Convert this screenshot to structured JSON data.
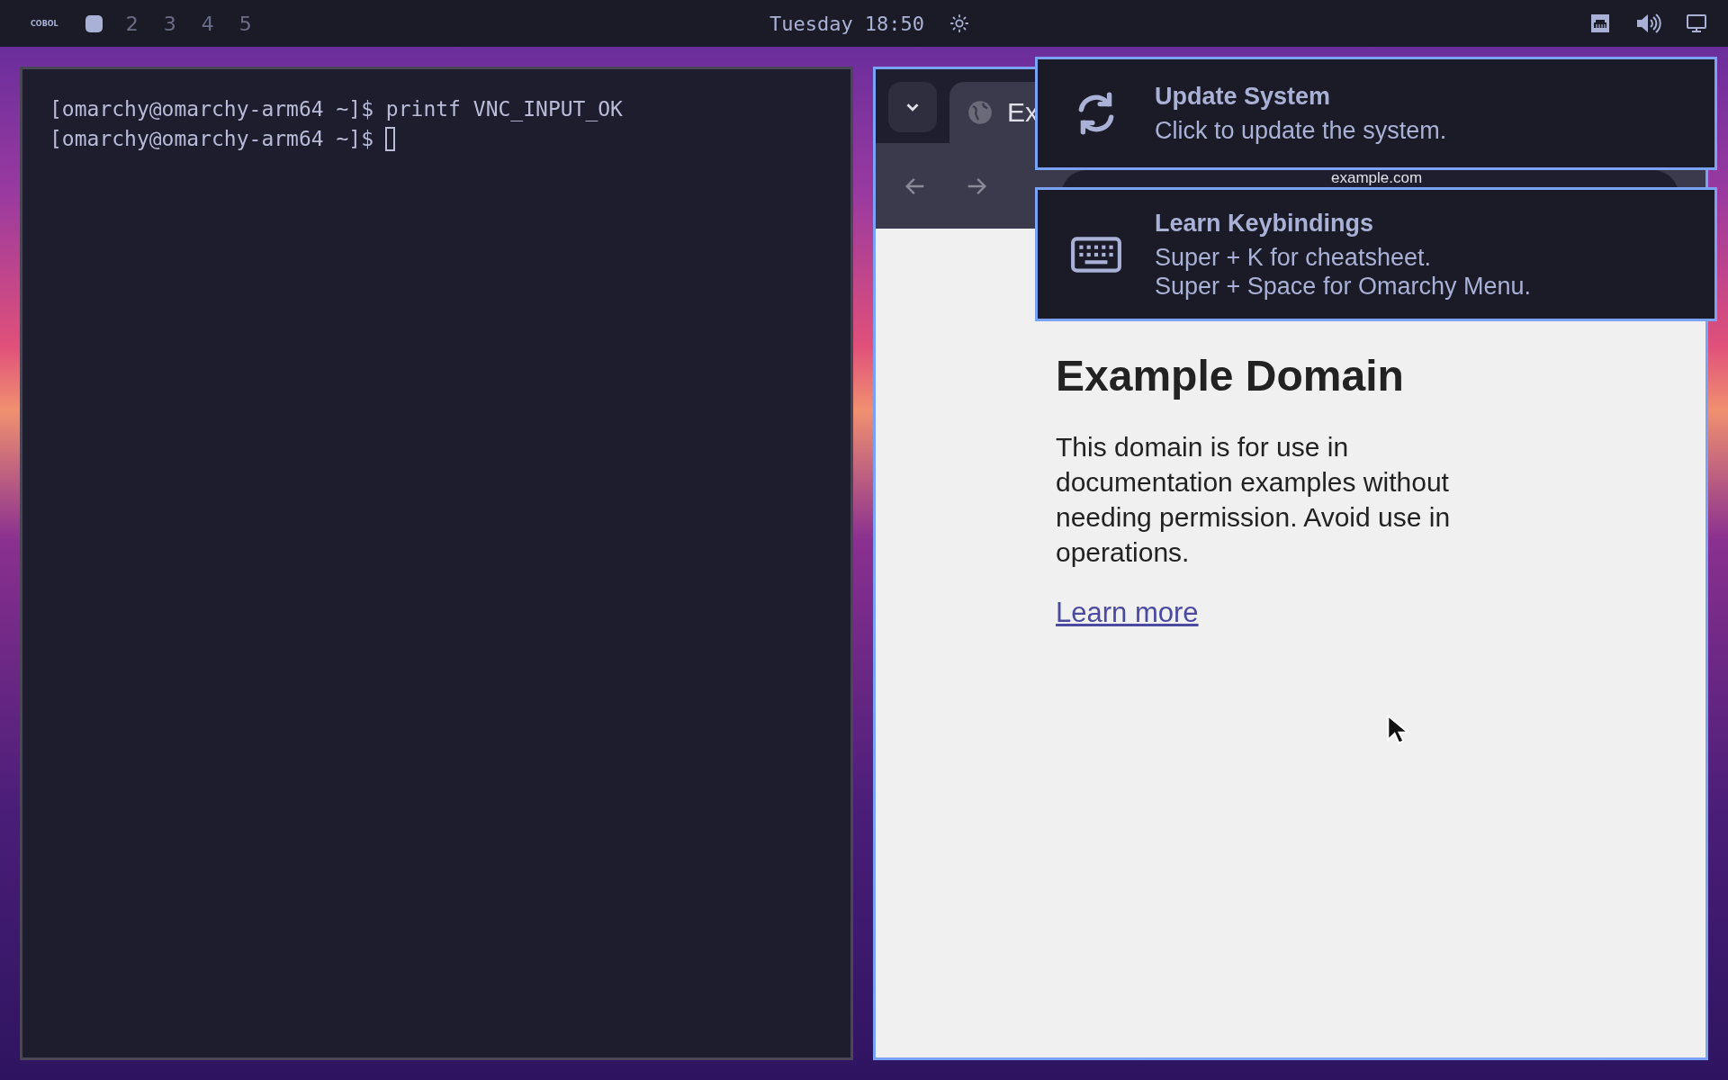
{
  "top_bar": {
    "logo": "COBOL",
    "workspaces": [
      {
        "selected": true
      },
      {
        "label": "2",
        "selected": false
      },
      {
        "label": "3",
        "selected": false
      },
      {
        "label": "4",
        "selected": false
      },
      {
        "label": "5",
        "selected": false
      }
    ],
    "clock": "Tuesday 18:50"
  },
  "terminal": {
    "lines": [
      {
        "text": "[omarchy@omarchy-arm64 ~]$ printf VNC_INPUT_OK",
        "cursor": false
      },
      {
        "text": "[omarchy@omarchy-arm64 ~]$",
        "cursor": true
      }
    ]
  },
  "browser": {
    "tab_label": "Ex",
    "address": "example.com",
    "page": {
      "heading": "Example Domain",
      "paragraph": "This domain is for use in documentation examples without needing permission. Avoid use in operations.",
      "link": "Learn more"
    }
  },
  "notifications": [
    {
      "kind": "update",
      "title": "Update System",
      "lines": [
        "Click to update the system."
      ]
    },
    {
      "kind": "keyboard",
      "title": "Learn Keybindings",
      "lines": [
        "Super + K for cheatsheet.",
        "Super + Space for Omarchy Menu."
      ]
    }
  ]
}
